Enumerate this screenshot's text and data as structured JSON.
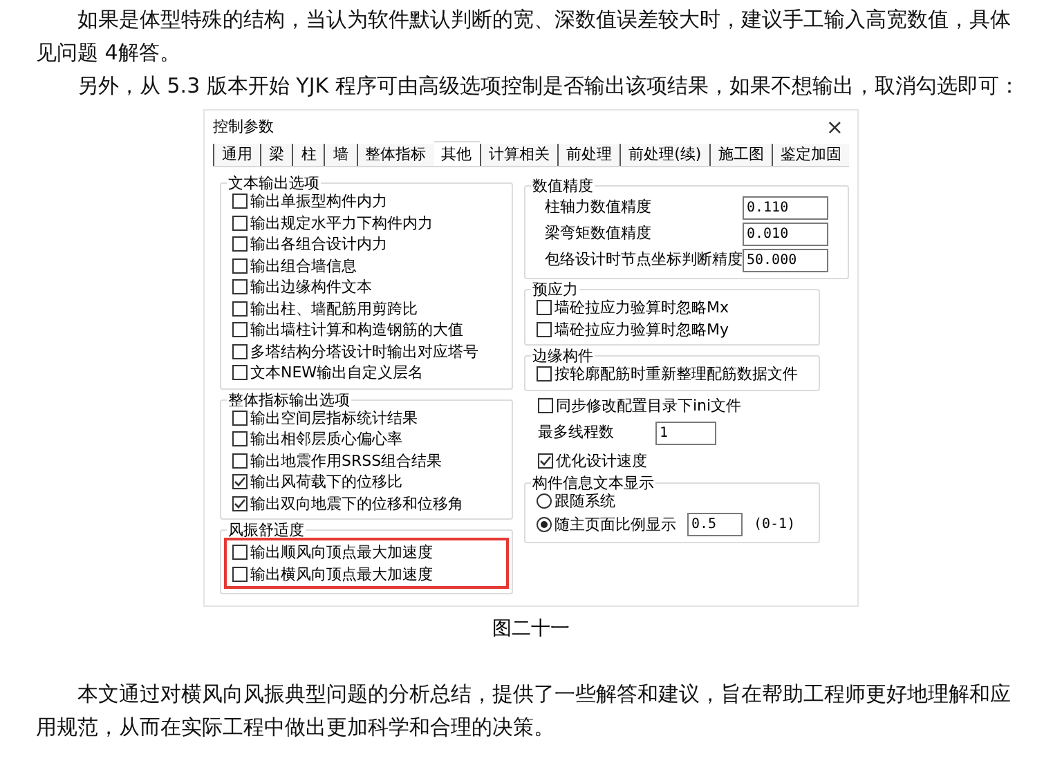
{
  "paragraphs_top": [
    "如果是体型特殊的结构，当认为软件默认判断的宽、深数值误差较大时，建议手工输入高宽数值，具体见问题 4解答。",
    "另外，从 5.3 版本开始 YJK 程序可由高级选项控制是否输出该项结果，如果不想输出，取消勾选即可："
  ],
  "dialog": {
    "title": "控制参数",
    "close": "×",
    "tabs": [
      {
        "label": "通用",
        "selected": false
      },
      {
        "label": "梁",
        "selected": false
      },
      {
        "label": "柱",
        "selected": false
      },
      {
        "label": "墙",
        "selected": false
      },
      {
        "label": "整体指标",
        "selected": false
      },
      {
        "label": "其他",
        "selected": true
      },
      {
        "label": "计算相关",
        "selected": false
      },
      {
        "label": "前处理",
        "selected": false
      },
      {
        "label": "前处理(续)",
        "selected": false
      },
      {
        "label": "施工图",
        "selected": false
      },
      {
        "label": "鉴定加固",
        "selected": false
      }
    ],
    "left_groups": [
      {
        "title": "文本输出选项",
        "highlighted": false,
        "items": [
          {
            "label": "输出单振型构件内力",
            "checked": false
          },
          {
            "label": "输出规定水平力下构件内力",
            "checked": false
          },
          {
            "label": "输出各组合设计内力",
            "checked": false
          },
          {
            "label": "输出组合墙信息",
            "checked": false
          },
          {
            "label": "输出边缘构件文本",
            "checked": false
          },
          {
            "label": "输出柱、墙配筋用剪跨比",
            "checked": false
          },
          {
            "label": "输出墙柱计算和构造钢筋的大值",
            "checked": false
          },
          {
            "label": "多塔结构分塔设计时输出对应塔号",
            "checked": false
          },
          {
            "label": "文本NEW输出自定义层名",
            "checked": false
          }
        ]
      },
      {
        "title": "整体指标输出选项",
        "highlighted": false,
        "items": [
          {
            "label": "输出空间层指标统计结果",
            "checked": false
          },
          {
            "label": "输出相邻层质心偏心率",
            "checked": false
          },
          {
            "label": "输出地震作用SRSS组合结果",
            "checked": false
          },
          {
            "label": "输出风荷载下的位移比",
            "checked": true
          },
          {
            "label": "输出双向地震下的位移和位移角",
            "checked": true
          }
        ]
      },
      {
        "title": "风振舒适度",
        "highlighted": true,
        "items": [
          {
            "label": "输出顺风向顶点最大加速度",
            "checked": false
          },
          {
            "label": "输出横风向顶点最大加速度",
            "checked": false
          }
        ]
      }
    ],
    "right_sections": [
      {
        "kind": "fields",
        "title": "数值精度",
        "items": [
          {
            "label": "柱轴力数值精度",
            "value": "0.110"
          },
          {
            "label": "梁弯矩数值精度",
            "value": "0.010"
          },
          {
            "label": "包络设计时节点坐标判断精度",
            "value": "50.000"
          }
        ]
      },
      {
        "kind": "checks",
        "title": "预应力",
        "items": [
          {
            "label": "墙砼拉应力验算时忽略Mx",
            "checked": false
          },
          {
            "label": "墙砼拉应力验算时忽略My",
            "checked": false
          }
        ]
      },
      {
        "kind": "checks",
        "title": "边缘构件",
        "items": [
          {
            "label": "按轮廓配筋时重新整理配筋数据文件",
            "checked": false
          }
        ]
      },
      {
        "kind": "check",
        "label": "同步修改配置目录下ini文件",
        "checked": false
      },
      {
        "kind": "field",
        "label": "最多线程数",
        "value": "1"
      },
      {
        "kind": "check",
        "label": "优化设计速度",
        "checked": true
      },
      {
        "kind": "radios",
        "title": "构件信息文本显示",
        "items": [
          {
            "label": "跟随系统",
            "selected": false
          },
          {
            "label": "随主页面比例显示",
            "selected": true,
            "value": "0.5",
            "note": "(0-1)"
          }
        ]
      }
    ]
  },
  "caption": "图二十一",
  "paragraphs_bottom": [
    "本文通过对横风向风振典型问题的分析总结，提供了一些解答和建议，旨在帮助工程师更好地理解和应用规范，从而在实际工程中做出更加科学和合理的决策。"
  ]
}
